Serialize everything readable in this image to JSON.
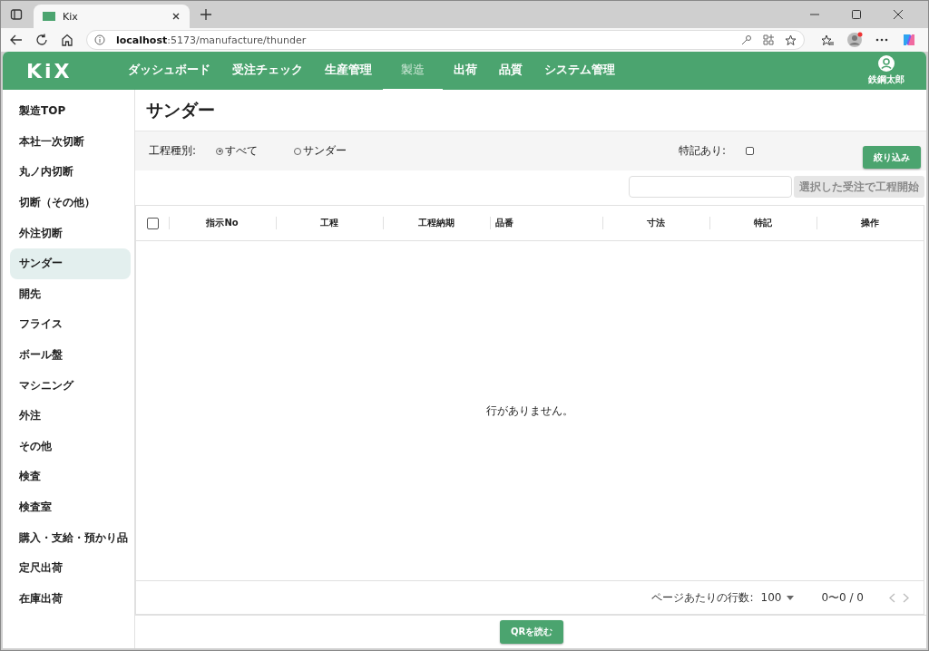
{
  "browser": {
    "tab_title": "Kix",
    "url": "**localhost**:5173/manufacture/thunder"
  },
  "header": {
    "logo": "KiX",
    "nav": [
      {
        "label": "ダッシュボード",
        "selected": false
      },
      {
        "label": "受注チェック",
        "selected": false
      },
      {
        "label": "生産管理",
        "selected": false
      },
      {
        "label": "製造",
        "selected": true
      },
      {
        "label": "出荷",
        "selected": false
      },
      {
        "label": "品質",
        "selected": false
      },
      {
        "label": "システム管理",
        "selected": false
      }
    ],
    "user": "鉄鋼太郎"
  },
  "sidebar": {
    "items": [
      {
        "label": "製造TOP",
        "selected": false
      },
      {
        "label": "本社一次切断",
        "selected": false
      },
      {
        "label": "丸ノ内切断",
        "selected": false
      },
      {
        "label": "切断（その他）",
        "selected": false
      },
      {
        "label": "外注切断",
        "selected": false
      },
      {
        "label": "サンダー",
        "selected": true
      },
      {
        "label": "開先",
        "selected": false
      },
      {
        "label": "フライス",
        "selected": false
      },
      {
        "label": "ボール盤",
        "selected": false
      },
      {
        "label": "マシニング",
        "selected": false
      },
      {
        "label": "外注",
        "selected": false
      },
      {
        "label": "その他",
        "selected": false
      },
      {
        "label": "検査",
        "selected": false
      },
      {
        "label": "検査室",
        "selected": false
      },
      {
        "label": "購入・支給・預かり品",
        "selected": false
      },
      {
        "label": "定尺出荷",
        "selected": false
      },
      {
        "label": "在庫出荷",
        "selected": false
      }
    ]
  },
  "page_title": "サンダー",
  "filter": {
    "label": "工程種別:",
    "options": [
      {
        "label": "すべて",
        "selected": true
      },
      {
        "label": "サンダー",
        "selected": false
      }
    ],
    "special": {
      "label": "特記あり:",
      "checked": false
    },
    "button": "絞り込み"
  },
  "start_button": {
    "label": "選択した受注で工程開始",
    "disabled": true
  },
  "table": {
    "select_all": {
      "checked": false
    },
    "columns": [
      {
        "label": "指示No"
      },
      {
        "label": "工程"
      },
      {
        "label": "工程納期"
      },
      {
        "label": "品番"
      },
      {
        "label": "寸法"
      },
      {
        "label": "特記"
      },
      {
        "label": "操作"
      }
    ],
    "empty_message": "行がありません。"
  },
  "pagination": {
    "rows_label": "ページあたりの行数:",
    "rows_value": "100",
    "range": "0〜0 / 0"
  },
  "qr_button": "QRを読む"
}
